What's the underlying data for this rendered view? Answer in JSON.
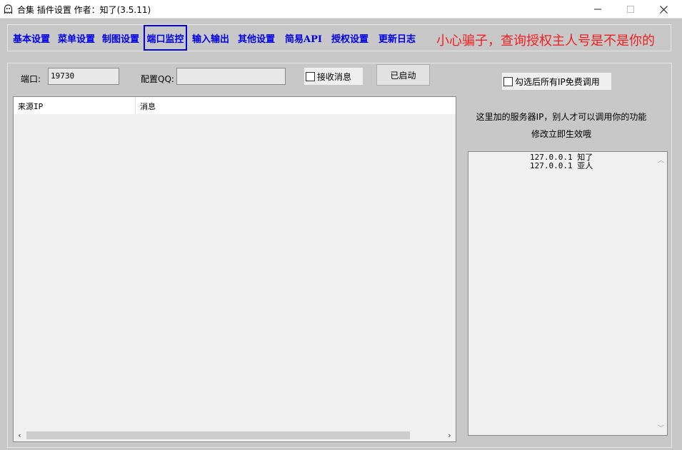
{
  "window": {
    "title": "合集 插件设置  作者：知了(3.5.11)",
    "icon": "ghost-icon",
    "minimize_icon": "minimize-icon",
    "maximize_icon": "maximize-icon",
    "close_icon": "close-icon"
  },
  "nav": {
    "tabs": [
      {
        "label": "基本设置"
      },
      {
        "label": "菜单设置"
      },
      {
        "label": "制图设置"
      },
      {
        "label": "端口监控",
        "active": true
      },
      {
        "label": "输入输出"
      },
      {
        "label": "其他设置"
      },
      {
        "label": "简易API"
      },
      {
        "label": "授权设置"
      },
      {
        "label": "更新日志"
      }
    ],
    "warning": "小心骗子，查询授权主人号是不是你的",
    "accent_color": "#0000e8",
    "warning_color": "#f02020"
  },
  "form": {
    "port_label": "端口:",
    "port_value": "19730",
    "qq_label": "配置QQ:",
    "qq_value": "",
    "receive_label": "接收消息",
    "start_button": "已启动",
    "free_ip_label": "勾选后所有IP免费调用"
  },
  "list": {
    "columns": [
      "来源IP",
      "消息"
    ],
    "rows": []
  },
  "servers": {
    "info_line1": "这里加的服务器IP，别人才可以调用你的功能",
    "info_line2": "修改立即生效哦",
    "entries": [
      "127.0.0.1 知了",
      "127.0.0.1 亚人"
    ]
  }
}
